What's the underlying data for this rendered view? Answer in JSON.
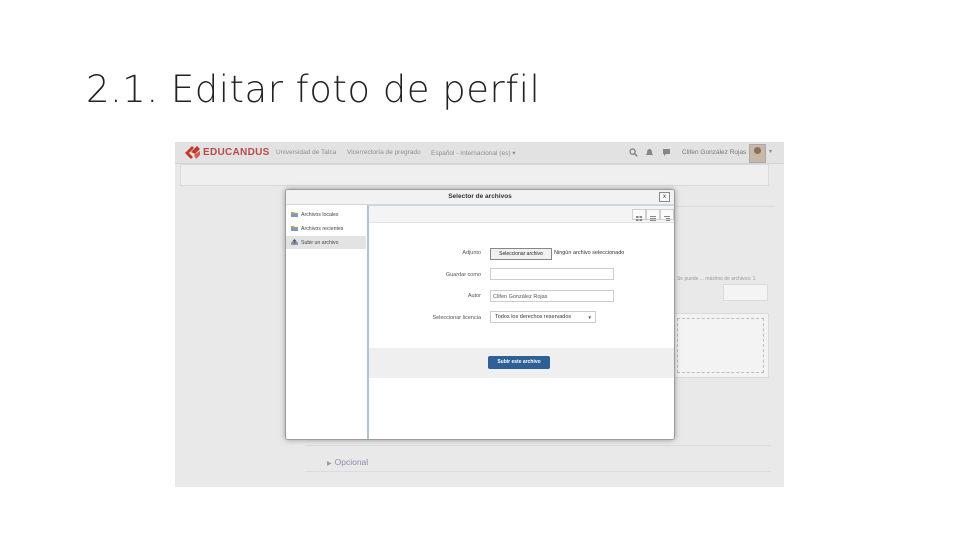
{
  "slide": {
    "title": "2.1. Editar foto de perfil"
  },
  "navbar": {
    "brand": "EDUCANDUS",
    "items": [
      "Universidad de Talca",
      "Vicerrectoría de pregrado",
      "Español - Internacional (es) ▾"
    ],
    "user_name": "Clifen González Rojas"
  },
  "background": {
    "side_note": "Se puede ... máximo de archivos: 1",
    "optional_label": "Opcional"
  },
  "dialog": {
    "title": "Selector de archivos",
    "close_glyph": "x",
    "repositories": [
      {
        "label": "Archivos locales",
        "icon": "folder-icon"
      },
      {
        "label": "Archivos recientes",
        "icon": "folder-icon"
      },
      {
        "label": "Subir un archivo",
        "icon": "upload-icon",
        "active": true
      }
    ],
    "form": {
      "file_label": "Adjunto",
      "file_button": "Seleccionar archivo",
      "file_status": "Ningún archivo seleccionado",
      "save_as_label": "Guardar como",
      "save_as_value": "",
      "author_label": "Autor",
      "author_value": "Clifen González Rojas",
      "license_label": "Seleccionar licencia",
      "license_value": "Todos los derechos reservados"
    },
    "submit_label": "Subir este archivo"
  },
  "colors": {
    "brand": "#b94a4a",
    "primary_button": "#2f5f94",
    "dialog_focus_border": "#a9c4dd"
  }
}
